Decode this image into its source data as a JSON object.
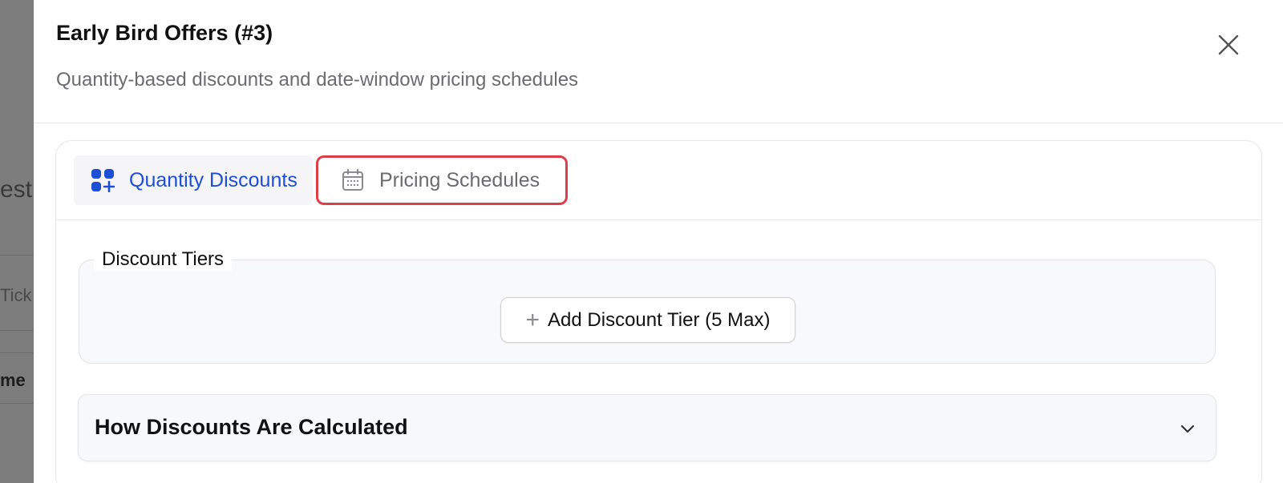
{
  "background": {
    "fragments": [
      "esti",
      "Tick",
      "me"
    ]
  },
  "drawer": {
    "title": "Early Bird Offers (#3)",
    "subtitle": "Quantity-based discounts and date-window pricing schedules",
    "close_icon": "close-icon"
  },
  "tabs": [
    {
      "label": "Quantity Discounts",
      "icon": "grid-plus-icon",
      "active": true
    },
    {
      "label": "Pricing Schedules",
      "icon": "calendar-icon",
      "active": false,
      "highlighted": true
    }
  ],
  "discount_tiers": {
    "legend": "Discount Tiers",
    "add_button_label": "Add Discount Tier (5 Max)"
  },
  "accordion": {
    "title": "How Discounts Are Calculated",
    "expanded": false
  },
  "colors": {
    "active_tab": "#1d4ed8",
    "highlight_border": "#dc3d46",
    "overlay": "#808080"
  }
}
